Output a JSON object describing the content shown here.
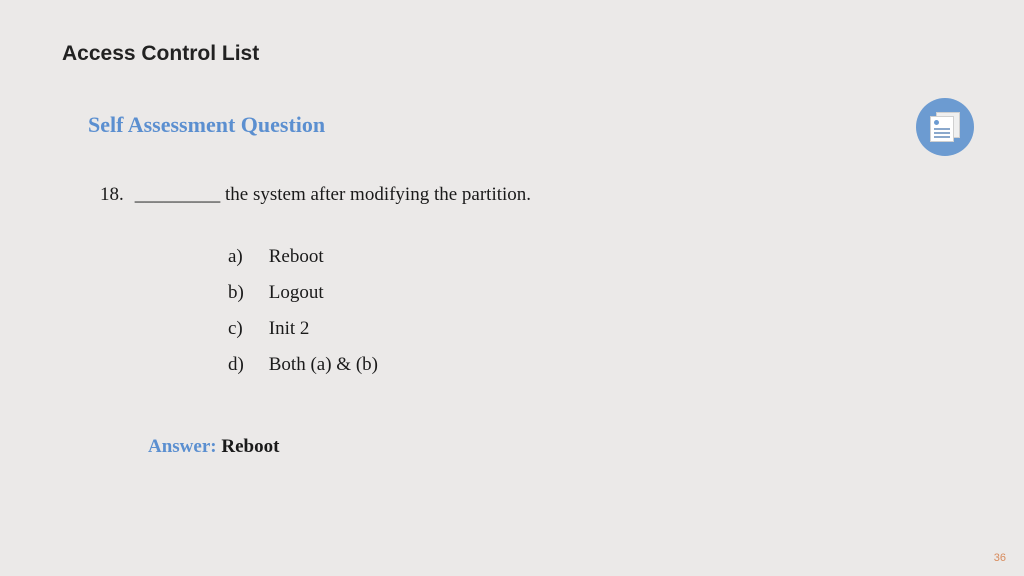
{
  "slide": {
    "title": "Access Control List",
    "subtitle": "Self Assessment Question",
    "page_number": "36"
  },
  "question": {
    "number": "18.",
    "text": "_________ the system after modifying the partition."
  },
  "options": [
    {
      "letter": "a)",
      "text": "Reboot"
    },
    {
      "letter": "b)",
      "text": "Logout"
    },
    {
      "letter": "c)",
      "text": "Init 2"
    },
    {
      "letter": "d)",
      "text": "Both (a) & (b)"
    }
  ],
  "answer": {
    "label": "Answer: ",
    "value": "Reboot"
  }
}
